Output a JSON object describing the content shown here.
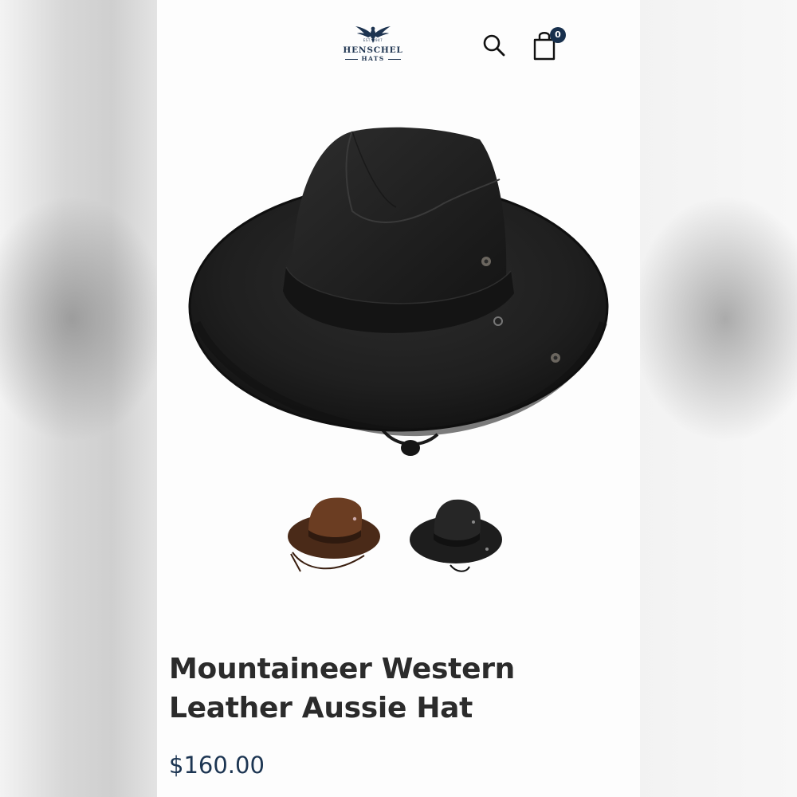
{
  "brand": {
    "est_text": "EST. 1947",
    "name": "HENSCHEL",
    "sub": "HATS",
    "logo_icon": "eagle-icon",
    "color": "#1e3450"
  },
  "header": {
    "search_icon": "search-icon",
    "cart_icon": "shopping-bag-icon",
    "cart_count": "0"
  },
  "gallery": {
    "main_image": "black-leather-aussie-hat",
    "thumbnails": [
      "brown-leather-hat-thumbnail",
      "black-leather-hat-thumbnail"
    ]
  },
  "product": {
    "title_line1": "Mountaineer Western",
    "title_line2": "Leather Aussie Hat",
    "price": "$160.00",
    "price_color": "#1c3552"
  }
}
